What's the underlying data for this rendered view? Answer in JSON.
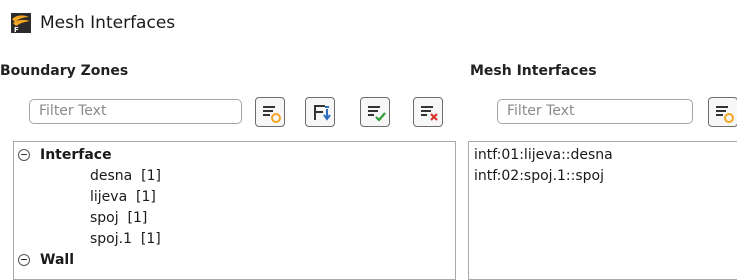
{
  "window": {
    "title": "Mesh Interfaces",
    "icon": "fluent-app-icon"
  },
  "boundary_zones": {
    "title": "Boundary Zones",
    "filter_placeholder": "Filter Text",
    "tool_icons": [
      "filter-icon",
      "filter-sort-icon",
      "select-all-icon",
      "deselect-all-icon"
    ],
    "groups": [
      {
        "label": "Interface",
        "expanded": true,
        "items": [
          "desna  [1]",
          "lijeva  [1]",
          "spoj  [1]",
          "spoj.1  [1]"
        ]
      },
      {
        "label": "Wall",
        "expanded": true,
        "items": []
      }
    ]
  },
  "mesh_interfaces": {
    "title": "Mesh Interfaces",
    "filter_placeholder": "Filter Text",
    "tool_icons": [
      "filter-icon"
    ],
    "items": [
      "intf:01:lijeva::desna",
      "intf:02:spoj.1::spoj"
    ]
  },
  "colors": {
    "icon_accent": "#f5a623",
    "icon_blue": "#2a6ebd",
    "icon_green": "#2e9e3a",
    "icon_red": "#d93025"
  }
}
